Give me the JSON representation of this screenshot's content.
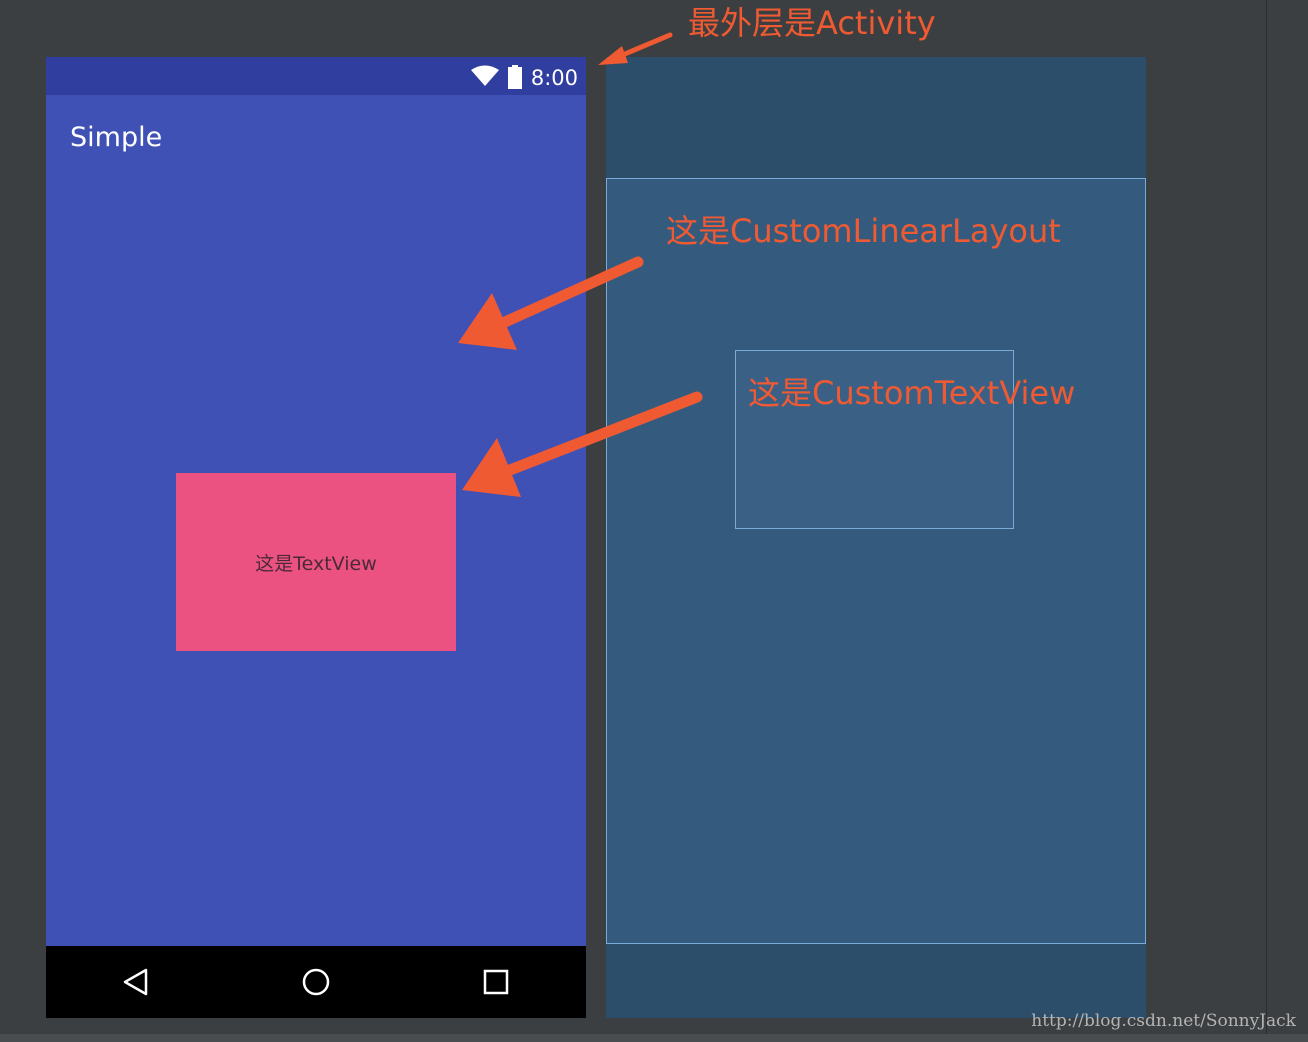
{
  "phone": {
    "status_bar": {
      "time": "8:00",
      "icons": [
        "wifi-icon",
        "battery-icon"
      ]
    },
    "app_title": "Simple",
    "textview_label": "这是TextView",
    "nav_buttons": [
      "back-icon",
      "home-icon",
      "recents-icon"
    ],
    "colors": {
      "primary": "#3f51b5",
      "primary_dark": "#303f9f",
      "accent": "#ec5281"
    }
  },
  "blueprint": {
    "colors": {
      "background": "#2d4e6b",
      "outline": "#7aaad6"
    }
  },
  "annotations": {
    "activity": "最外层是Activity",
    "custom_linear_layout": "这是CustomLinearLayout",
    "custom_text_view": "这是CustomTextView",
    "color": "#f05a32"
  },
  "watermark": "http://blog.csdn.net/SonnyJack"
}
